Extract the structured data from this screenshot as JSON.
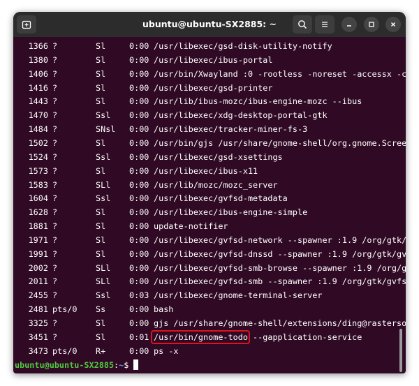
{
  "window": {
    "title": "ubuntu@ubuntu-SX2885: ~"
  },
  "titlebar_icons": {
    "new_tab": "new-tab-icon",
    "search": "search-icon",
    "menu": "hamburger-menu-icon",
    "minimize": "minimize-icon",
    "maximize": "maximize-icon",
    "close": "close-icon"
  },
  "process_rows": [
    {
      "pid": "1366",
      "tty": "?",
      "stat": "Sl",
      "time": "0:00",
      "command": "/usr/libexec/gsd-disk-utility-notify"
    },
    {
      "pid": "1380",
      "tty": "?",
      "stat": "Sl",
      "time": "0:00",
      "command": "/usr/libexec/ibus-portal"
    },
    {
      "pid": "1406",
      "tty": "?",
      "stat": "Sl",
      "time": "0:00",
      "command": "/usr/bin/Xwayland :0 -rootless -noreset -accessx -c"
    },
    {
      "pid": "1416",
      "tty": "?",
      "stat": "Sl",
      "time": "0:00",
      "command": "/usr/libexec/gsd-printer"
    },
    {
      "pid": "1443",
      "tty": "?",
      "stat": "Sl",
      "time": "0:00",
      "command": "/usr/lib/ibus-mozc/ibus-engine-mozc --ibus"
    },
    {
      "pid": "1470",
      "tty": "?",
      "stat": "Ssl",
      "time": "0:00",
      "command": "/usr/libexec/xdg-desktop-portal-gtk"
    },
    {
      "pid": "1484",
      "tty": "?",
      "stat": "SNsl",
      "time": "0:00",
      "command": "/usr/libexec/tracker-miner-fs-3"
    },
    {
      "pid": "1502",
      "tty": "?",
      "stat": "Sl",
      "time": "0:00",
      "command": "/usr/bin/gjs /usr/share/gnome-shell/org.gnome.Scree"
    },
    {
      "pid": "1524",
      "tty": "?",
      "stat": "Ssl",
      "time": "0:00",
      "command": "/usr/libexec/gsd-xsettings"
    },
    {
      "pid": "1573",
      "tty": "?",
      "stat": "Sl",
      "time": "0:00",
      "command": "/usr/libexec/ibus-x11"
    },
    {
      "pid": "1583",
      "tty": "?",
      "stat": "SLl",
      "time": "0:00",
      "command": "/usr/lib/mozc/mozc_server"
    },
    {
      "pid": "1604",
      "tty": "?",
      "stat": "Ssl",
      "time": "0:00",
      "command": "/usr/libexec/gvfsd-metadata"
    },
    {
      "pid": "1628",
      "tty": "?",
      "stat": "Sl",
      "time": "0:00",
      "command": "/usr/libexec/ibus-engine-simple"
    },
    {
      "pid": "1881",
      "tty": "?",
      "stat": "Sl",
      "time": "0:00",
      "command": "update-notifier"
    },
    {
      "pid": "1971",
      "tty": "?",
      "stat": "Sl",
      "time": "0:00",
      "command": "/usr/libexec/gvfsd-network --spawner :1.9 /org/gtk/"
    },
    {
      "pid": "1991",
      "tty": "?",
      "stat": "Sl",
      "time": "0:00",
      "command": "/usr/libexec/gvfsd-dnssd --spawner :1.9 /org/gtk/gv"
    },
    {
      "pid": "2002",
      "tty": "?",
      "stat": "SLl",
      "time": "0:00",
      "command": "/usr/libexec/gvfsd-smb-browse --spawner :1.9 /org/g"
    },
    {
      "pid": "2011",
      "tty": "?",
      "stat": "SLl",
      "time": "0:00",
      "command": "/usr/libexec/gvfsd-smb --spawner :1.9 /org/gtk/gvfs"
    },
    {
      "pid": "2455",
      "tty": "?",
      "stat": "Ssl",
      "time": "0:03",
      "command": "/usr/libexec/gnome-terminal-server"
    },
    {
      "pid": "2481",
      "tty": "pts/0",
      "stat": "Ss",
      "time": "0:00",
      "command": "bash"
    },
    {
      "pid": "3325",
      "tty": "?",
      "stat": "Sl",
      "time": "0:00",
      "command": "gjs /usr/share/gnome-shell/extensions/ding@rasterso"
    },
    {
      "pid": "3451",
      "tty": "?",
      "stat": "Sl",
      "time": "0:01",
      "command": "/usr/bin/gnome-todo --gapplication-service"
    },
    {
      "pid": "3473",
      "tty": "pts/0",
      "stat": "R+",
      "time": "0:00",
      "command": "ps -x"
    }
  ],
  "highlighted_row_index": 21,
  "prompt": {
    "user_host": "ubuntu@ubuntu-SX2885",
    "separator": ":",
    "path": "~",
    "symbol": "$ "
  },
  "colors": {
    "terminal_bg": "#300a24",
    "titlebar_bg": "#2c2c2c",
    "prompt_user": "#4fc93f",
    "prompt_path": "#5d9ce6",
    "highlight_box": "#e0121b"
  }
}
